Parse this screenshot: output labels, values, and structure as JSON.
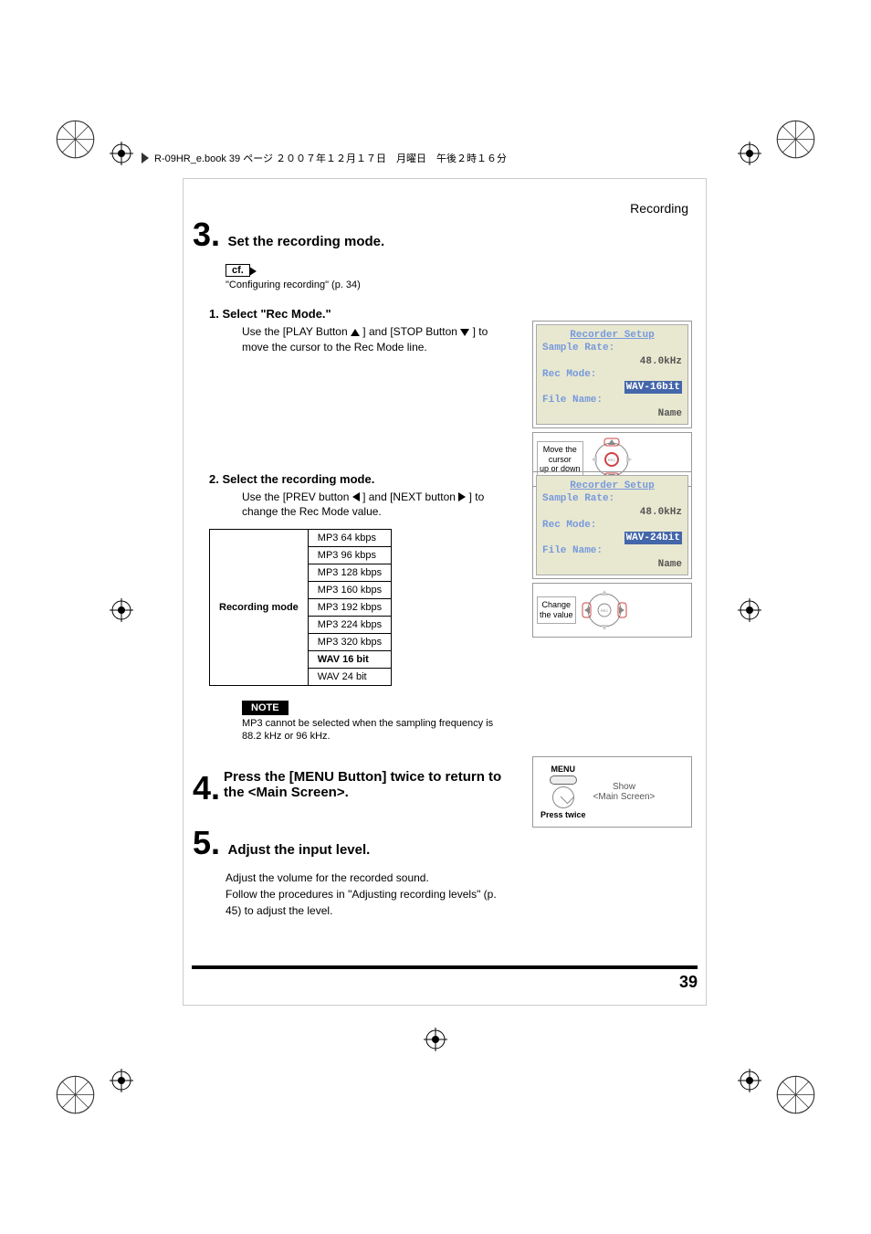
{
  "header": {
    "bookmark": "R-09HR_e.book  39 ページ  ２００７年１２月１７日　月曜日　午後２時１６分",
    "section": "Recording"
  },
  "step3": {
    "num": "3.",
    "title": "Set the recording mode.",
    "cf_label": "cf.",
    "cf_text": "\"Configuring recording\" (p. 34)",
    "sub1": {
      "title": "1.  Select \"Rec Mode.\"",
      "body_a": "Use the [PLAY Button ",
      "body_b": " ] and [STOP Button ",
      "body_c": " ] to move the cursor to the Rec Mode line."
    },
    "sub2": {
      "title": "2.  Select the recording mode.",
      "body_a": "Use the [PREV button ",
      "body_b": " ] and [NEXT button ",
      "body_c": " ] to change the Rec Mode value."
    },
    "table": {
      "header": "Recording mode",
      "rows": [
        "MP3 64 kbps",
        "MP3 96 kbps",
        "MP3 128 kbps",
        "MP3 160 kbps",
        "MP3 192 kbps",
        "MP3 224 kbps",
        "MP3 320 kbps",
        "WAV 16 bit",
        "WAV 24 bit"
      ],
      "bold_index": 7
    },
    "note_label": "NOTE",
    "note_text": "MP3 cannot be selected when the sampling frequency is 88.2 kHz or 96 kHz."
  },
  "step4": {
    "num": "4.",
    "title": "Press the [MENU Button] twice to return to the <Main Screen>.",
    "menu_label": "MENU",
    "press_twice": "Press twice",
    "show_a": "Show",
    "show_b": "<Main Screen>"
  },
  "step5": {
    "num": "5.",
    "title": "Adjust the input level.",
    "body": "Adjust the volume for the recorded sound.\nFollow the procedures in \"Adjusting recording levels\" (p. 45) to adjust the level."
  },
  "screen1": {
    "title": "Recorder Setup",
    "l1": "Sample Rate:",
    "v1": "48.0kHz",
    "l2": "Rec Mode:",
    "v2": "WAV-16bit",
    "l3": "File Name:",
    "v3": "Name",
    "hint": "Move the\ncursor\nup or down"
  },
  "screen2": {
    "title": "Recorder Setup",
    "l1": "Sample Rate:",
    "v1": "48.0kHz",
    "l2": "Rec Mode:",
    "v2": "WAV-24bit",
    "l3": "File Name:",
    "v3": "Name",
    "hint": "Change\nthe value"
  },
  "page_num": "39"
}
